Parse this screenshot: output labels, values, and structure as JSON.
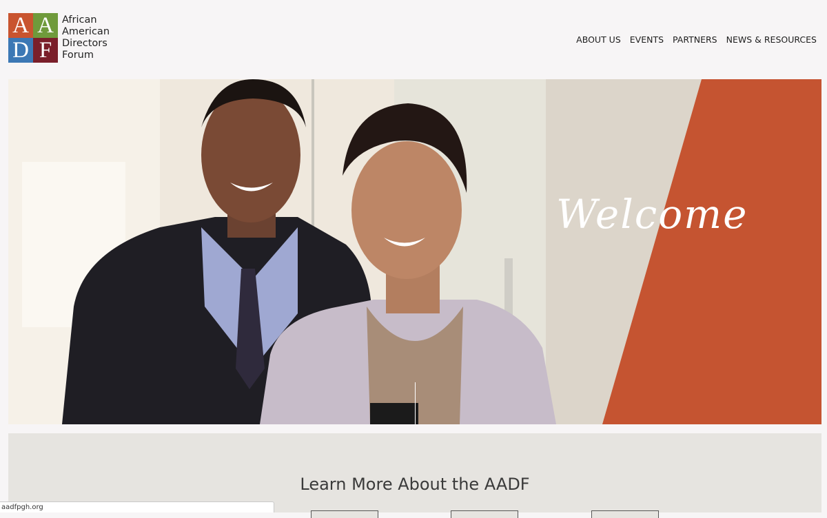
{
  "logo": {
    "letters": [
      "A",
      "A",
      "D",
      "F"
    ],
    "colors": [
      "#c9542f",
      "#6f9a3b",
      "#3c78b5",
      "#7a1f2a"
    ],
    "text_lines": [
      "African",
      "American",
      "Directors",
      "Forum"
    ]
  },
  "nav": {
    "items": [
      "ABOUT US",
      "EVENTS",
      "PARTNERS",
      "NEWS & RESOURCES"
    ]
  },
  "hero": {
    "welcome_text": "Welcome",
    "accent_color": "#c55431"
  },
  "learn_more": {
    "title": "Learn More About the AADF"
  },
  "status_bar": {
    "url": "aadfpgh.org"
  }
}
